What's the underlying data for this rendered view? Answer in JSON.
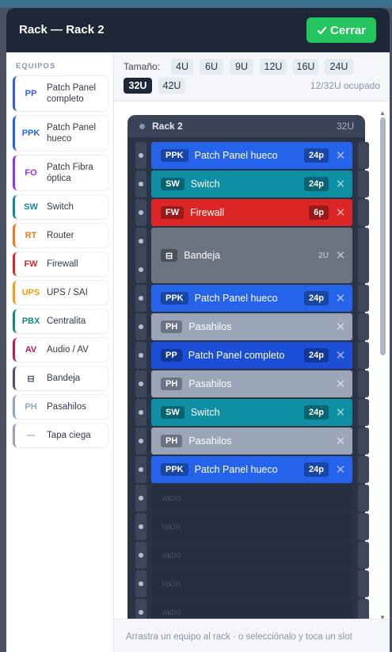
{
  "header": {
    "title": "Rack — Rack 2",
    "close_label": "Cerrar",
    "close_icon": "check-icon"
  },
  "sidebar": {
    "heading": "EQUIPOS",
    "items": [
      {
        "code": "PP",
        "label": "Patch Panel completo",
        "color": "#3b5bdb"
      },
      {
        "code": "PPK",
        "label": "Patch Panel hueco",
        "color": "#2563eb"
      },
      {
        "code": "FO",
        "label": "Patch Fibra óptica",
        "color": "#9333ea"
      },
      {
        "code": "SW",
        "label": "Switch",
        "color": "#0e8a99"
      },
      {
        "code": "RT",
        "label": "Router",
        "color": "#ea7a1a"
      },
      {
        "code": "FW",
        "label": "Firewall",
        "color": "#dc2626"
      },
      {
        "code": "UPS",
        "label": "UPS / SAI",
        "color": "#f59e0b"
      },
      {
        "code": "PBX",
        "label": "Centralita",
        "color": "#0f8a7a"
      },
      {
        "code": "AV",
        "label": "Audio / AV",
        "color": "#be185d"
      },
      {
        "code": "⊟",
        "label": "Bandeja",
        "color": "#4b5563"
      },
      {
        "code": "PH",
        "label": "Pasahilos",
        "color": "#94a3b8"
      },
      {
        "code": "—",
        "label": "Tapa ciega",
        "color": "#9ca3af"
      }
    ]
  },
  "sizes": {
    "label": "Tamaño:",
    "options": [
      "4U",
      "6U",
      "9U",
      "12U",
      "16U",
      "24U",
      "32U",
      "42U"
    ],
    "selected": "32U",
    "occupancy": "12/32U ocupado"
  },
  "rack": {
    "name": "Rack 2",
    "capacity": "32U",
    "slots": [
      {
        "code": "PPK",
        "name": "Patch Panel hueco",
        "ports": "24p",
        "color": "#2563eb",
        "units": 1
      },
      {
        "code": "SW",
        "name": "Switch",
        "ports": "24p",
        "color": "#0e8fa3",
        "units": 1
      },
      {
        "code": "FW",
        "name": "Firewall",
        "ports": "6p",
        "color": "#dc2626",
        "units": 1
      },
      {
        "code": "⊟",
        "name": "Bandeja",
        "ports": "2U",
        "color": "#6b7280",
        "units": 2
      },
      {
        "code": "PPK",
        "name": "Patch Panel hueco",
        "ports": "24p",
        "color": "#2563eb",
        "units": 1
      },
      {
        "code": "PH",
        "name": "Pasahilos",
        "ports": "",
        "color": "#9aa6b8",
        "units": 1
      },
      {
        "code": "PP",
        "name": "Patch Panel completo",
        "ports": "24p",
        "color": "#1d4ed8",
        "units": 1
      },
      {
        "code": "PH",
        "name": "Pasahilos",
        "ports": "",
        "color": "#9aa6b8",
        "units": 1
      },
      {
        "code": "SW",
        "name": "Switch",
        "ports": "24p",
        "color": "#0e8fa3",
        "units": 1
      },
      {
        "code": "PH",
        "name": "Pasahilos",
        "ports": "",
        "color": "#9aa6b8",
        "units": 1
      },
      {
        "code": "PPK",
        "name": "Patch Panel hueco",
        "ports": "24p",
        "color": "#2563eb",
        "units": 1
      }
    ],
    "empty_label": "vacío",
    "empty_count": 5,
    "remove_icon": "close-icon"
  },
  "footer": {
    "hint": "Arrastra un equipo al rack · o selecciónalo y toca un slot"
  }
}
